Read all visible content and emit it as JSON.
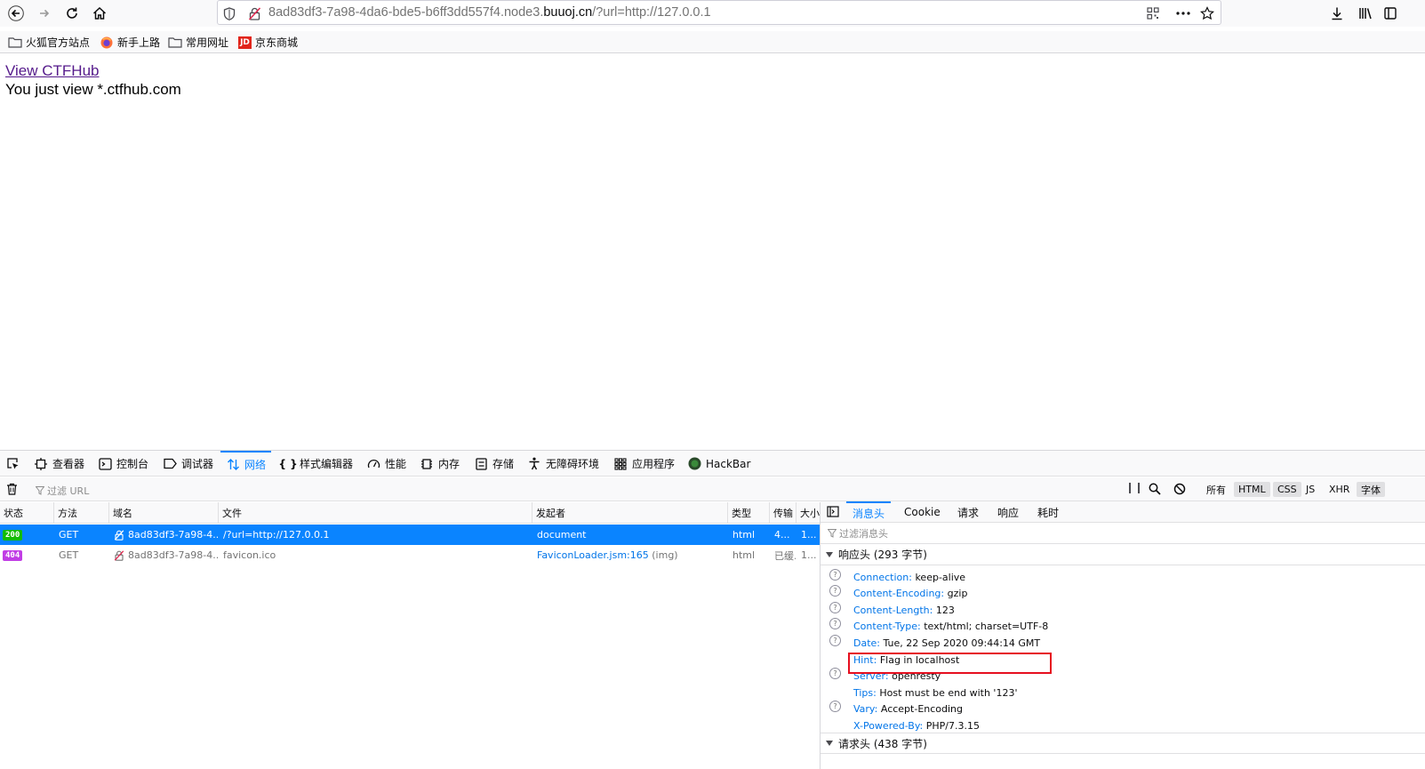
{
  "browser": {
    "url_prefix": "8ad83df3-7a98-4da6-bde5-b6ff3dd557f4.node3.",
    "url_host": "buuoj.cn",
    "url_suffix": "/?url=http://127.0.0.1",
    "bookmarks": [
      "火狐官方站点",
      "新手上路",
      "常用网址",
      "京东商城"
    ],
    "jd_logo": "JD"
  },
  "page": {
    "link_text": "View CTFHub",
    "body_text": "You just view *.ctfhub.com"
  },
  "devtools": {
    "tabs": [
      "查看器",
      "控制台",
      "调试器",
      "网络",
      "样式编辑器",
      "性能",
      "内存",
      "存储",
      "无障碍环境",
      "应用程序",
      "HackBar"
    ],
    "active_tab": "网络",
    "filter_placeholder": "过滤 URL",
    "type_filters": [
      "所有",
      "HTML",
      "CSS",
      "JS",
      "XHR",
      "字体"
    ],
    "columns": [
      "状态",
      "方法",
      "域名",
      "文件",
      "发起者",
      "类型",
      "传输",
      "大小"
    ],
    "requests": [
      {
        "status": "200",
        "method": "GET",
        "domain": "8ad83df3-7a98-4...",
        "file": "/?url=http://127.0.0.1",
        "initiator": "document",
        "initiator_extra": "",
        "type": "html",
        "transferred": "4...",
        "size": "1...",
        "status_color": "#12bc00"
      },
      {
        "status": "404",
        "method": "GET",
        "domain": "8ad83df3-7a98-4...",
        "file": "favicon.ico",
        "initiator": "FaviconLoader.jsm:165",
        "initiator_extra": "(img)",
        "type": "html",
        "transferred": "已缓...",
        "size": "1...",
        "status_color": "#c13de5"
      }
    ],
    "side_tabs": [
      "消息头",
      "Cookie",
      "请求",
      "响应",
      "耗时"
    ],
    "side_active": "消息头",
    "side_filter_placeholder": "过滤消息头",
    "response_section": "响应头 (293 字节)",
    "request_section": "请求头 (438 字节)",
    "response_headers": [
      {
        "name": "Connection:",
        "value": "keep-alive",
        "help": true
      },
      {
        "name": "Content-Encoding:",
        "value": "gzip",
        "help": true
      },
      {
        "name": "Content-Length:",
        "value": "123",
        "help": true
      },
      {
        "name": "Content-Type:",
        "value": "text/html; charset=UTF-8",
        "help": true
      },
      {
        "name": "Date:",
        "value": "Tue, 22 Sep 2020 09:44:14 GMT",
        "help": true
      },
      {
        "name": "Hint:",
        "value": "Flag in localhost",
        "help": false
      },
      {
        "name": "Server:",
        "value": "openresty",
        "help": true
      },
      {
        "name": "Tips:",
        "value": "Host must be end with '123'",
        "help": false
      },
      {
        "name": "Vary:",
        "value": "Accept-Encoding",
        "help": true
      },
      {
        "name": "X-Powered-By:",
        "value": "PHP/7.3.15",
        "help": false
      }
    ]
  },
  "colors": {
    "accent": "#0a84ff",
    "highlight_box": "#e60f1f"
  }
}
